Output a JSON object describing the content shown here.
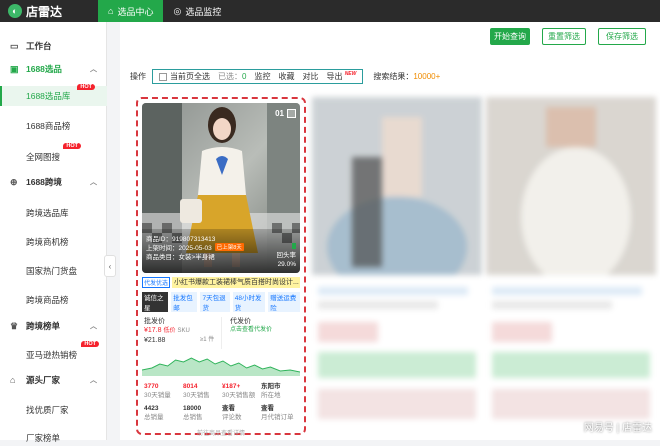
{
  "topbar": {
    "app_name": "店雷达",
    "tabs": [
      {
        "label": "选品中心",
        "icon": "home-icon",
        "active": true
      },
      {
        "label": "选品监控",
        "icon": "location-icon",
        "active": false
      }
    ]
  },
  "sidebar": {
    "workbench": "工作台",
    "group1688": "1688选品",
    "item_library": "1688选品库",
    "item_rank": "1688商品榜",
    "item_image": "全网图搜",
    "group_cross": "1688跨境",
    "item_cross_library": "跨境选品库",
    "item_cross_chance": "跨境商机榜",
    "item_hot_goods": "国家热门货盘",
    "item_cross_rank": "跨境商品榜",
    "group_rank": "跨境榜单",
    "item_amazon": "亚马逊热销榜",
    "group_factory": "源头厂家",
    "item_find_factory": "找优质厂家",
    "item_factory_rank": "厂家榜单",
    "hot": "HOT"
  },
  "toolbar": {
    "query": "开始查询",
    "reset": "重置筛选",
    "save": "保存筛选"
  },
  "ops": {
    "label": "操作",
    "select_all": "当前页全选",
    "selected_label": "已选：",
    "selected_count": "0",
    "monitor": "监控",
    "collect": "收藏",
    "compare": "对比",
    "export": "导出",
    "new": "NEW",
    "result_label": "搜索结果：",
    "result_count": "10000+"
  },
  "card": {
    "index": "01",
    "product_id": "商品ID：919807313413",
    "launch_date": "上架时间：2025-05-03",
    "launch_tag": "已上架8天",
    "category": "商品类目：女装>半身裙",
    "repurchase_label": "回头率",
    "repurchase_value": "29.0%",
    "title_tag": "代发优选",
    "title": "小红书爆款工装裙棒气质百搭时尚设计...",
    "shop_tag": "诚信之星",
    "tags": [
      "批发包邮",
      "7天包退货",
      "48小时发货",
      "赠送运费险"
    ],
    "price_label": "批发价",
    "price": "¥17.8",
    "price_tag": "低价",
    "sku": "SKU",
    "price2": "¥21.88",
    "count": "≥1 件",
    "dist_label": "代发价",
    "dist_tag": "点击查看代发价",
    "stats": [
      {
        "value": "3770",
        "label": "30天销量"
      },
      {
        "value": "8014",
        "label": "30天销售"
      },
      {
        "value": "¥187+",
        "label": "30天销售额"
      },
      {
        "value": "东阳市",
        "label": "所在地"
      },
      {
        "value": "4423",
        "label": "总销量"
      },
      {
        "value": "18000",
        "label": "总销售"
      },
      {
        "value": "查看",
        "label": "评论数"
      },
      {
        "value": "查看",
        "label": "月代销订单"
      }
    ],
    "footer": "前往商品查看详情"
  },
  "watermark": "网易号 | 店雷达",
  "colors": {
    "accent": "#23a84a",
    "highlight": "#d9363e",
    "price": "#f5222d"
  }
}
